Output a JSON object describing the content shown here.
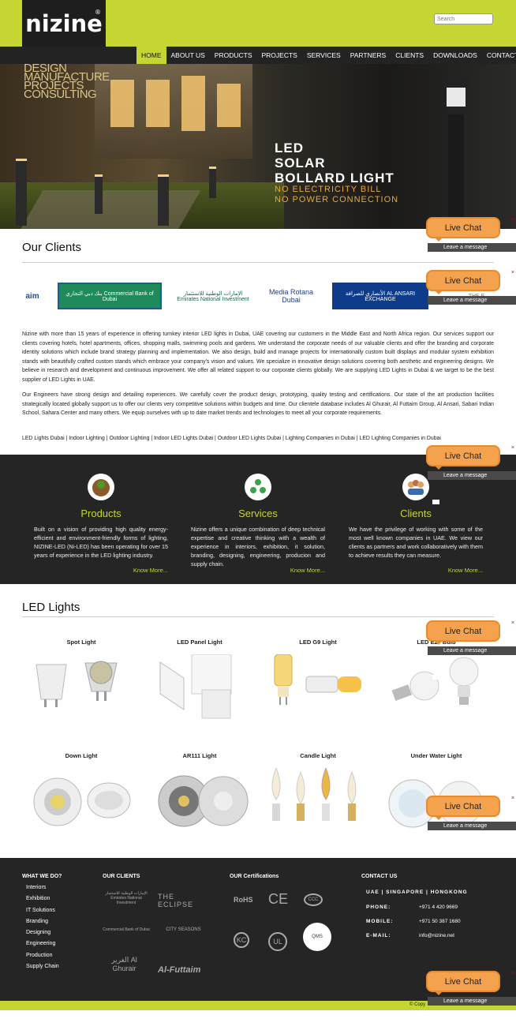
{
  "brand": {
    "name": "nizine",
    "reg": "®"
  },
  "search": {
    "placeholder": "Search"
  },
  "nav": [
    "HOME",
    "ABOUT US",
    "PRODUCTS",
    "PROJECTS",
    "SERVICES",
    "PARTNERS",
    "CLIENTS",
    "DOWNLOADS",
    "CONTACT US"
  ],
  "hero": {
    "tagline": [
      "DESIGN",
      "MANUFACTURE",
      "PROJECTS",
      "CONSULTING"
    ],
    "headline": [
      "LED",
      "SOLAR",
      "BOLLARD LIGHT"
    ],
    "sub": [
      "NO ELECTRICITY BILL",
      "NO POWER CONNECTION"
    ]
  },
  "clients_title": "Our Clients",
  "client_logos": [
    "aim",
    "بنك دبي التجاري Commercial Bank of Dubai",
    "الإمارات الوطنية للاستثمار Emirates National Investment",
    "Media Rotana Dubai",
    "الأنصاري للصرافة AL ANSARI EXCHANGE",
    "THE E"
  ],
  "about_p1": "Nizine with more than 15 years of experience in offering turnkey interior LED lights in Dubai, UAE covering our customers in the Middle East and North Africa region. Our services support our clients covering hotels, hotel apartments, offices, shopping malls, swimming pools and gardens. We understand the corporate needs of our valuable clients and offer the branding and corporate identity solutions which include brand strategy planning and implementation. We also design, build and manage projects for internationally custom built displays and modular system exhibition stands with beautifully crafted custom stands which embrace your company's vision and values. We specialize in innovative design solutions covering both aesthetic and engineering designs. We believe in research and development and continuous improvement. We offer all related support to our corporate clients globally. We are supplying LED Lights in Dubai & we target to be the best supplier of LED Lights in UAE.",
  "about_p2": "Our Engineers have strong design and detailing experiences. We carefully cover the product design, prototyping, quality testing and certifications. Our state of the art production facilities strategically located globally support us to offer our clients very competitive solutions within budgets and time. Our clientele database includes Al Ghurair, Al Futtaim Group, Al Ansari, Sabari Indian School, Sahara Center and many others. We equip ourselves with up to date market trends and technologies to meet all your corporate requirements.",
  "seo_links": "LED Lights Dubai | Indoor Lighting | Outdoor Lighting | Indoor LED Lights Dubai | Outdoor LED Lights Dubai | Lighting Companies in Dubai | LED Lighting Companies in Dubai",
  "features": [
    {
      "title": "Products",
      "text": "Built on a vision of providing high quality energy-efficient and environment-friendly forms of lighting, NIZINE-LED (Ni-LED) has been operating for over 15 years of experience in the LED lighting industry.",
      "more": "Know More..."
    },
    {
      "title": "Services",
      "text": "Nizine offers a unique combination of deep technical expertise and creative thinking with a wealth of experience in interiors, exhibition, it solution, branding, designing, engineering, producion and supply chain.",
      "more": "Know More..."
    },
    {
      "title": "Clients",
      "text": "We have the privilege of working with some of the most well known companies in UAE. We view our clients as partners and work collaboratively with them to achieve results they can measure.",
      "more": "Know More..."
    }
  ],
  "led_title": "LED Lights",
  "products": [
    "Spot Light",
    "LED Panel Light",
    "LED G9 Light",
    "LED E27 Bulb",
    "Down Light",
    "AR111 Light",
    "Candle Light",
    "Under Water Light"
  ],
  "footer": {
    "what_title": "WHAT WE DO?",
    "what": [
      "Interiors",
      "Exhibition",
      "IT Solutions",
      "Branding",
      "Designing",
      "Engineering",
      "Production",
      "Supply Chain"
    ],
    "clients_title": "OUR CLIENTS",
    "clients": [
      "الإمارات الوطنية للاستثمار Emirates National Investment",
      "THE ECLIPSE",
      "Commercial Bank of Dubai",
      "CITY SEASONS",
      "الغرير Al Ghurair",
      "Al-Futtaim"
    ],
    "cert_title": "OUR Certifications",
    "certs": [
      "RoHS",
      "CE",
      "CCC",
      "KC",
      "UL",
      "QMS"
    ],
    "contact_title": "CONTACT US",
    "locations": "UAE | SINGAPORE | HONGKONG",
    "phone_label": "PHONE:",
    "phone": "+971 4 420 9669",
    "mobile_label": "MOBILE:",
    "mobile": "+971 50 387 1680",
    "email_label": "E-MAIL:",
    "email": "info@nizine.net",
    "copyright": "© Copy"
  },
  "live_chat": {
    "label": "Live Chat",
    "message": "Leave a message",
    "close": "×"
  },
  "colors": {
    "accent": "#c5d531",
    "dark": "#252525",
    "chat": "#f5a24e"
  }
}
